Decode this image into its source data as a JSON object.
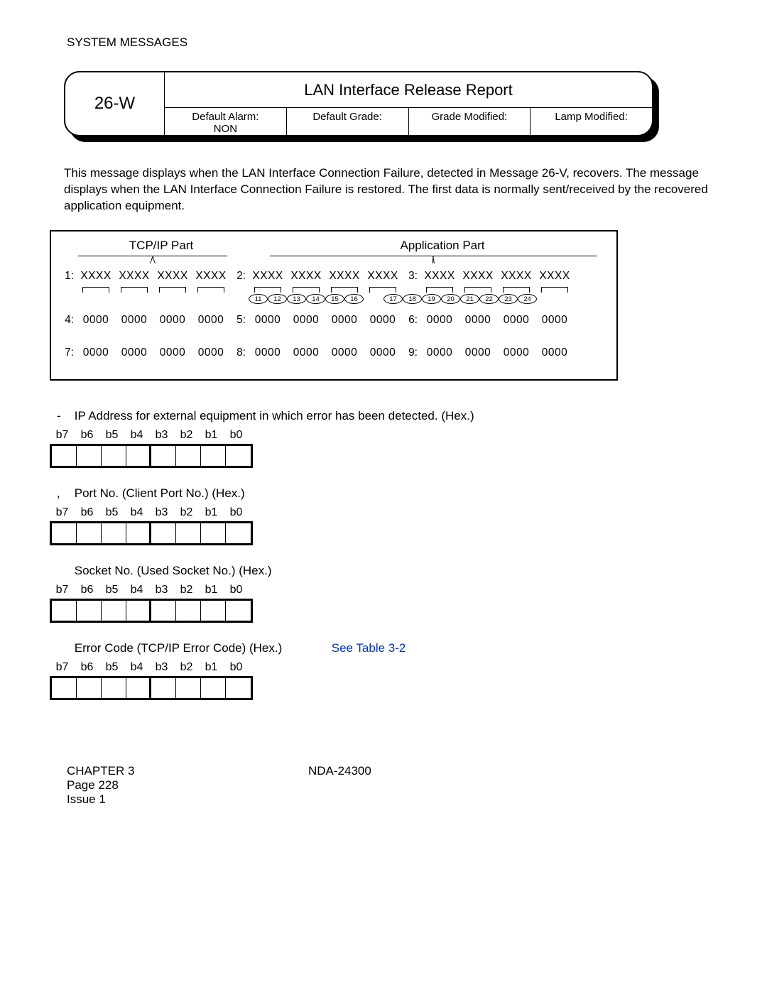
{
  "header_section": "SYSTEM MESSAGES",
  "msg_code": "26-W",
  "msg_title": "LAN Interface Release Report",
  "hdr_cells": {
    "c1a": "Default Alarm:",
    "c1b": "NON",
    "c2": "Default Grade:",
    "c3": "Grade Modified:",
    "c4": "Lamp Modified:"
  },
  "paragraph": "This message displays when the LAN Interface Connection Failure, detected in Message 26-V, recovers. The message displays when the LAN Interface Connection Failure is restored. The first data is normally sent/received by the recovered application equipment.",
  "parts": {
    "a": "TCP/IP Part",
    "b": "Application Part"
  },
  "rows": {
    "x": "XXXX",
    "z": "0000",
    "r1": "1:",
    "r2": "2:",
    "r3": "3:",
    "r4": "4:",
    "r5": "5:",
    "r6": "6:",
    "r7": "7:",
    "r8": "8:",
    "r9": "9:"
  },
  "circled": [
    "11",
    "12",
    "13",
    "14",
    "15",
    "16",
    "17",
    "18",
    "19",
    "20",
    "21",
    "22",
    "23",
    "24"
  ],
  "fields": {
    "f1": {
      "prefix": "-",
      "label": "IP Address for external equipment in which error has been detected. (Hex.)"
    },
    "f2": {
      "prefix": ",",
      "label": "Port No. (Client Port No.) (Hex.)"
    },
    "f3": {
      "prefix": "",
      "label": "Socket No. (Used Socket No.) (Hex.)"
    },
    "f4": {
      "prefix": "",
      "label": "Error Code (TCP/IP Error Code) (Hex.)",
      "see_a": "See ",
      "see_b": "Table 3-2"
    }
  },
  "bits": [
    "b7",
    "b6",
    "b5",
    "b4",
    "b3",
    "b2",
    "b1",
    "b0"
  ],
  "footer": {
    "chapter": "CHAPTER 3",
    "page": "Page 228",
    "issue": "Issue 1",
    "docnum": "NDA-24300"
  }
}
